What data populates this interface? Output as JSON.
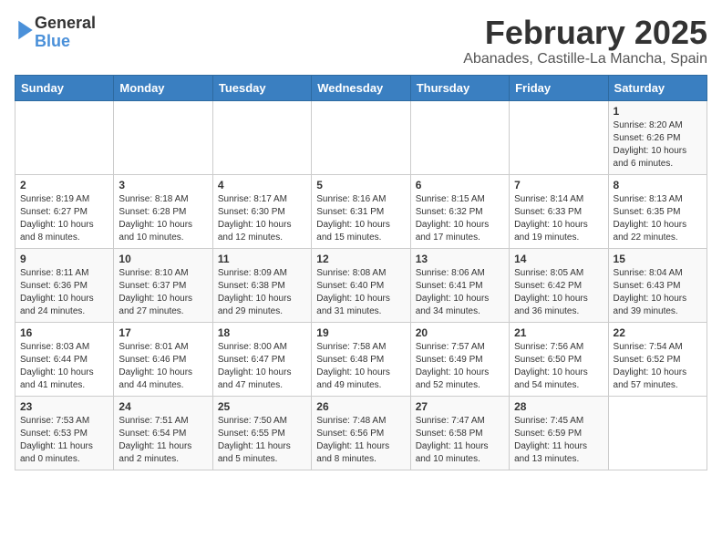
{
  "header": {
    "logo_line1": "General",
    "logo_line2": "Blue",
    "title": "February 2025",
    "subtitle": "Abanades, Castille-La Mancha, Spain"
  },
  "weekdays": [
    "Sunday",
    "Monday",
    "Tuesday",
    "Wednesday",
    "Thursday",
    "Friday",
    "Saturday"
  ],
  "weeks": [
    [
      {
        "day": "",
        "detail": ""
      },
      {
        "day": "",
        "detail": ""
      },
      {
        "day": "",
        "detail": ""
      },
      {
        "day": "",
        "detail": ""
      },
      {
        "day": "",
        "detail": ""
      },
      {
        "day": "",
        "detail": ""
      },
      {
        "day": "1",
        "detail": "Sunrise: 8:20 AM\nSunset: 6:26 PM\nDaylight: 10 hours\nand 6 minutes."
      }
    ],
    [
      {
        "day": "2",
        "detail": "Sunrise: 8:19 AM\nSunset: 6:27 PM\nDaylight: 10 hours\nand 8 minutes."
      },
      {
        "day": "3",
        "detail": "Sunrise: 8:18 AM\nSunset: 6:28 PM\nDaylight: 10 hours\nand 10 minutes."
      },
      {
        "day": "4",
        "detail": "Sunrise: 8:17 AM\nSunset: 6:30 PM\nDaylight: 10 hours\nand 12 minutes."
      },
      {
        "day": "5",
        "detail": "Sunrise: 8:16 AM\nSunset: 6:31 PM\nDaylight: 10 hours\nand 15 minutes."
      },
      {
        "day": "6",
        "detail": "Sunrise: 8:15 AM\nSunset: 6:32 PM\nDaylight: 10 hours\nand 17 minutes."
      },
      {
        "day": "7",
        "detail": "Sunrise: 8:14 AM\nSunset: 6:33 PM\nDaylight: 10 hours\nand 19 minutes."
      },
      {
        "day": "8",
        "detail": "Sunrise: 8:13 AM\nSunset: 6:35 PM\nDaylight: 10 hours\nand 22 minutes."
      }
    ],
    [
      {
        "day": "9",
        "detail": "Sunrise: 8:11 AM\nSunset: 6:36 PM\nDaylight: 10 hours\nand 24 minutes."
      },
      {
        "day": "10",
        "detail": "Sunrise: 8:10 AM\nSunset: 6:37 PM\nDaylight: 10 hours\nand 27 minutes."
      },
      {
        "day": "11",
        "detail": "Sunrise: 8:09 AM\nSunset: 6:38 PM\nDaylight: 10 hours\nand 29 minutes."
      },
      {
        "day": "12",
        "detail": "Sunrise: 8:08 AM\nSunset: 6:40 PM\nDaylight: 10 hours\nand 31 minutes."
      },
      {
        "day": "13",
        "detail": "Sunrise: 8:06 AM\nSunset: 6:41 PM\nDaylight: 10 hours\nand 34 minutes."
      },
      {
        "day": "14",
        "detail": "Sunrise: 8:05 AM\nSunset: 6:42 PM\nDaylight: 10 hours\nand 36 minutes."
      },
      {
        "day": "15",
        "detail": "Sunrise: 8:04 AM\nSunset: 6:43 PM\nDaylight: 10 hours\nand 39 minutes."
      }
    ],
    [
      {
        "day": "16",
        "detail": "Sunrise: 8:03 AM\nSunset: 6:44 PM\nDaylight: 10 hours\nand 41 minutes."
      },
      {
        "day": "17",
        "detail": "Sunrise: 8:01 AM\nSunset: 6:46 PM\nDaylight: 10 hours\nand 44 minutes."
      },
      {
        "day": "18",
        "detail": "Sunrise: 8:00 AM\nSunset: 6:47 PM\nDaylight: 10 hours\nand 47 minutes."
      },
      {
        "day": "19",
        "detail": "Sunrise: 7:58 AM\nSunset: 6:48 PM\nDaylight: 10 hours\nand 49 minutes."
      },
      {
        "day": "20",
        "detail": "Sunrise: 7:57 AM\nSunset: 6:49 PM\nDaylight: 10 hours\nand 52 minutes."
      },
      {
        "day": "21",
        "detail": "Sunrise: 7:56 AM\nSunset: 6:50 PM\nDaylight: 10 hours\nand 54 minutes."
      },
      {
        "day": "22",
        "detail": "Sunrise: 7:54 AM\nSunset: 6:52 PM\nDaylight: 10 hours\nand 57 minutes."
      }
    ],
    [
      {
        "day": "23",
        "detail": "Sunrise: 7:53 AM\nSunset: 6:53 PM\nDaylight: 11 hours\nand 0 minutes."
      },
      {
        "day": "24",
        "detail": "Sunrise: 7:51 AM\nSunset: 6:54 PM\nDaylight: 11 hours\nand 2 minutes."
      },
      {
        "day": "25",
        "detail": "Sunrise: 7:50 AM\nSunset: 6:55 PM\nDaylight: 11 hours\nand 5 minutes."
      },
      {
        "day": "26",
        "detail": "Sunrise: 7:48 AM\nSunset: 6:56 PM\nDaylight: 11 hours\nand 8 minutes."
      },
      {
        "day": "27",
        "detail": "Sunrise: 7:47 AM\nSunset: 6:58 PM\nDaylight: 11 hours\nand 10 minutes."
      },
      {
        "day": "28",
        "detail": "Sunrise: 7:45 AM\nSunset: 6:59 PM\nDaylight: 11 hours\nand 13 minutes."
      },
      {
        "day": "",
        "detail": ""
      }
    ]
  ]
}
